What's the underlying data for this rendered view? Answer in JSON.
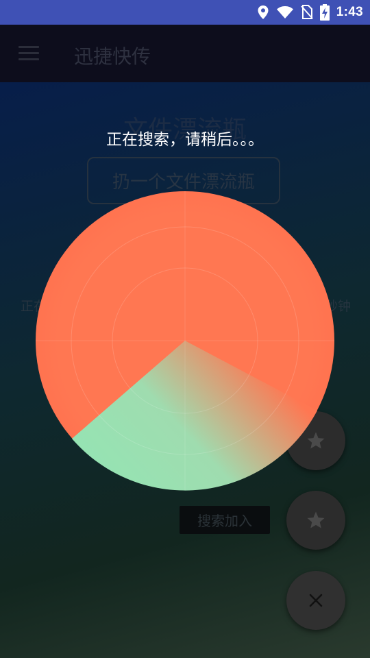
{
  "status_bar": {
    "time": "1:43",
    "icons": [
      "location-icon",
      "wifi-icon",
      "no-sim-icon",
      "battery-charging-icon"
    ]
  },
  "app_bar": {
    "menu_icon": "hamburger-menu-icon",
    "title": "迅捷快传"
  },
  "content": {
    "title": "文件漂流瓶",
    "throw_button_label": "扔一个文件漂流瓶",
    "status_left_fragment": "正在",
    "status_right_fragment": "秒钟",
    "search_join_label": "搜索加入"
  },
  "fabs": [
    {
      "icon": "star-icon"
    },
    {
      "icon": "star-icon"
    },
    {
      "icon": "close-icon"
    }
  ],
  "overlay": {
    "message": "正在搜索，请稍后。。。",
    "radar_color": "#ff7752",
    "sweep_color": "#96e3b3"
  }
}
